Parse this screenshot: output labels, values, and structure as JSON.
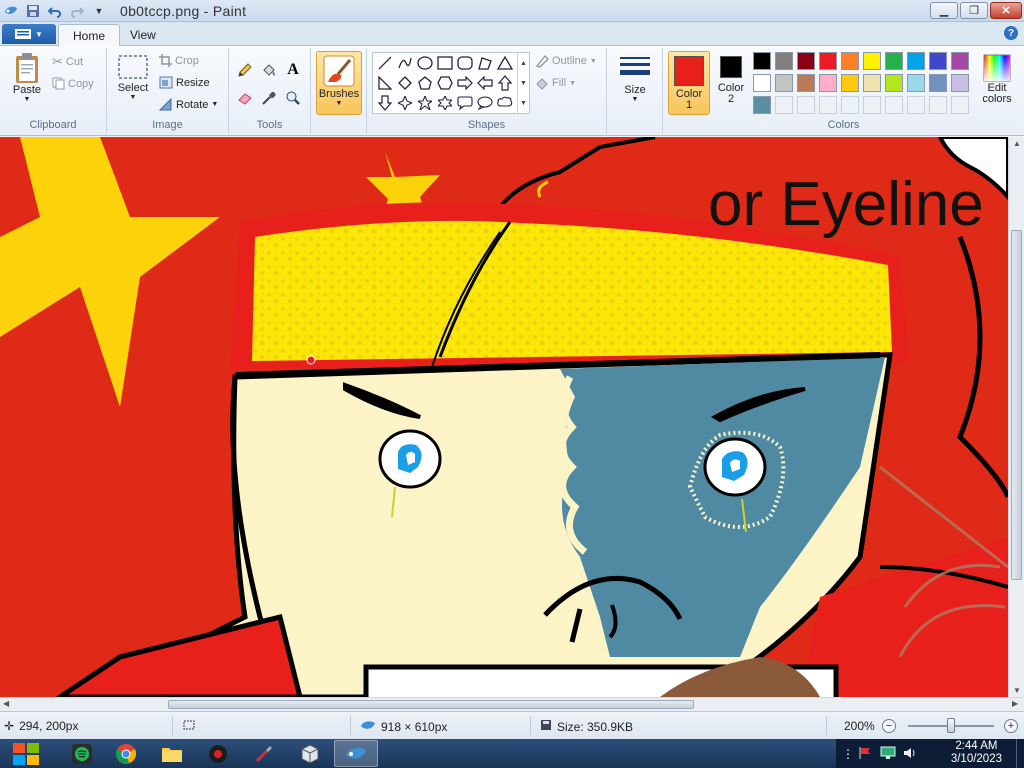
{
  "window": {
    "title": "0b0tccp.png - Paint",
    "controls": [
      "minimize",
      "maximize",
      "close"
    ]
  },
  "tabs": [
    {
      "label": "Home",
      "active": true
    },
    {
      "label": "View",
      "active": false
    }
  ],
  "ribbon": {
    "clipboard": {
      "label": "Clipboard",
      "paste": "Paste",
      "cut": "Cut",
      "copy": "Copy"
    },
    "image": {
      "label": "Image",
      "select": "Select",
      "crop": "Crop",
      "resize": "Resize",
      "rotate": "Rotate"
    },
    "tools": {
      "label": "Tools",
      "items": [
        "pencil",
        "fill",
        "text",
        "eraser",
        "color-picker",
        "magnifier"
      ]
    },
    "brushes": {
      "label": "Brushes"
    },
    "shapes": {
      "label": "Shapes",
      "outline": "Outline",
      "fill": "Fill"
    },
    "size": {
      "label": "Size"
    },
    "color1": {
      "label_line1": "Color",
      "label_line2": "1",
      "value": "#e8201c"
    },
    "color2": {
      "label_line1": "Color",
      "label_line2": "2",
      "value": "#000000"
    },
    "colors": {
      "label": "Colors",
      "edit_line1": "Edit",
      "edit_line2": "colors",
      "row1": [
        "#000000",
        "#7f7f7f",
        "#880015",
        "#ed1c24",
        "#ff7f27",
        "#fff200",
        "#22b14c",
        "#00a2e8",
        "#3f48cc",
        "#a349a4"
      ],
      "row2": [
        "#ffffff",
        "#c3c3c3",
        "#b97a57",
        "#ffaec9",
        "#ffc90e",
        "#efe4b0",
        "#b5e61d",
        "#99d9ea",
        "#7092be",
        "#c8bfe7"
      ],
      "row3": [
        "#5b8ea0"
      ]
    }
  },
  "canvas": {
    "text_overlay": "or Eyeline",
    "palette": {
      "red": "#de2a16",
      "yellow": "#fbe705",
      "skin": "#fcf4c6",
      "blue": "#4f8aa2",
      "star": "#fcd20a"
    }
  },
  "statusbar": {
    "cursor_pos": "294, 200px",
    "selection_size": "",
    "image_size": "918 × 610px",
    "file_size": "Size: 350.9KB",
    "zoom": "200%",
    "zoom_level": 0.5
  },
  "taskbar": {
    "apps": [
      "start",
      "spotify",
      "chrome",
      "file-explorer",
      "obs",
      "tool",
      "virtualbox",
      "paint"
    ],
    "active": "paint",
    "time": "2:44 AM",
    "date": "3/10/2023"
  }
}
